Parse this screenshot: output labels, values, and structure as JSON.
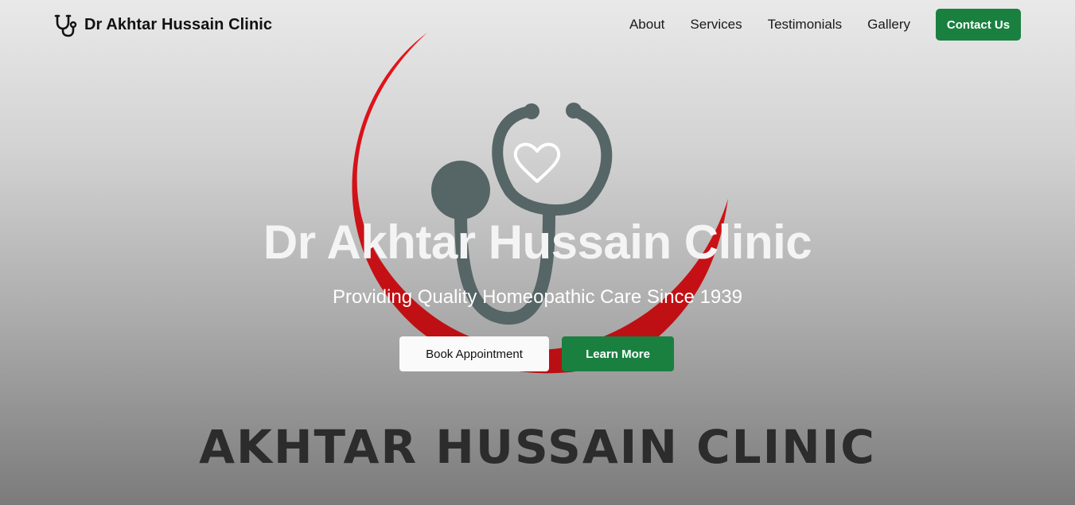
{
  "brand": {
    "name": "Dr Akhtar Hussain Clinic",
    "icon": "stethoscope-icon"
  },
  "nav": {
    "links": [
      "About",
      "Services",
      "Testimonials",
      "Gallery"
    ],
    "contact_label": "Contact Us"
  },
  "hero": {
    "title": "Dr Akhtar Hussain Clinic",
    "subtitle": "Providing Quality Homeopathic Care Since 1939",
    "book_label": "Book Appointment",
    "learn_label": "Learn More",
    "logo_text": "AKHTAR HUSSAIN CLINIC"
  },
  "colors": {
    "accent_green": "#1a8040",
    "crescent_red": "#d8121a",
    "stethoscope_gray": "#566566"
  }
}
